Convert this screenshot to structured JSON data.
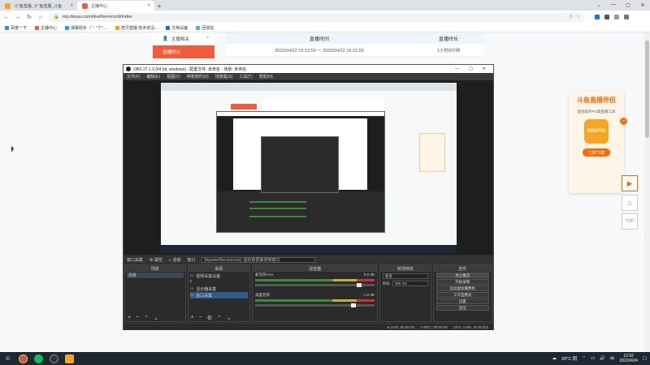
{
  "browser": {
    "tabs": [
      {
        "title": "斗\"鱼直播_斗\"鱼直播_斗鱼",
        "active": false
      },
      {
        "title": "主播中心",
        "active": true
      }
    ],
    "new_tab": "+",
    "url": "mp.douyu.com/live/liverecord/index",
    "bookmarks": [
      "百度一下",
      "主播中心",
      "弹幕助手（ \"· \"个\"…",
      "虎牙直播 技术前沿...",
      "文档设备",
      "回收站"
    ]
  },
  "page": {
    "menu": [
      {
        "label": "主播相关",
        "active": false
      },
      {
        "label": "直播时长",
        "active": true
      }
    ],
    "table": {
      "headers": [
        "直播时间",
        "直播时长"
      ],
      "rows": [
        {
          "time": "2022/04/22 15:12:59 ～ 2022/04/22 16:21:03",
          "duration": "1小时8分钟"
        }
      ]
    },
    "promo": {
      "title": "斗鱼直播伴侣",
      "subtitle": "超低延时PC端直播工具",
      "logo_text": "DOUYU",
      "button": "立即下载",
      "close": "×"
    },
    "float_buttons": {
      "play": "▶",
      "home": "⌂",
      "top": "TOP"
    }
  },
  "obs": {
    "title": "OBS 27.1.3 (64 bit, windows) - 配置文件: 未命名 - 场景: 未命名",
    "menu": [
      "文件(F)",
      "编辑(E)",
      "视图(V)",
      "停靠部件(D)",
      "场景集(S)",
      "工具(T)",
      "帮助(H)"
    ],
    "source_toolbar": {
      "label": "窗口采集",
      "properties": "属性",
      "filters": "滤镜",
      "window_label": "窗口",
      "window_value": "[ApowerRecord.exe]: 鼠标即屏幕录制窗口"
    },
    "docks": {
      "scenes": {
        "title": "场景",
        "items": [
          "场景"
        ]
      },
      "sources": {
        "title": "来源",
        "items": [
          "视频采集设备",
          "T",
          "显示器采集",
          "窗口采集"
        ]
      },
      "mixer": {
        "title": "混音器",
        "channels": [
          {
            "name": "麦克风/Aux",
            "db": "0.0 dB"
          },
          {
            "name": "桌面音频",
            "db": "-1.6 dB"
          }
        ]
      },
      "transitions": {
        "title": "转场特效",
        "type": "渐变",
        "duration_label": "时长",
        "duration": "300 ms"
      },
      "controls": {
        "title": "控件",
        "buttons": [
          "停止推流",
          "开始录制",
          "启动虚拟摄像机",
          "工作室模式",
          "设置",
          "退出"
        ]
      }
    },
    "status": {
      "live": "LIVE: 00:00:00",
      "rec": "REC: 00:00:00",
      "cpu": "CPU: 3.9%, 40.00 fps"
    }
  },
  "taskbar": {
    "weather": "20°C 阴",
    "time": "12:52",
    "date": "2022/4/24",
    "lang": "中"
  }
}
